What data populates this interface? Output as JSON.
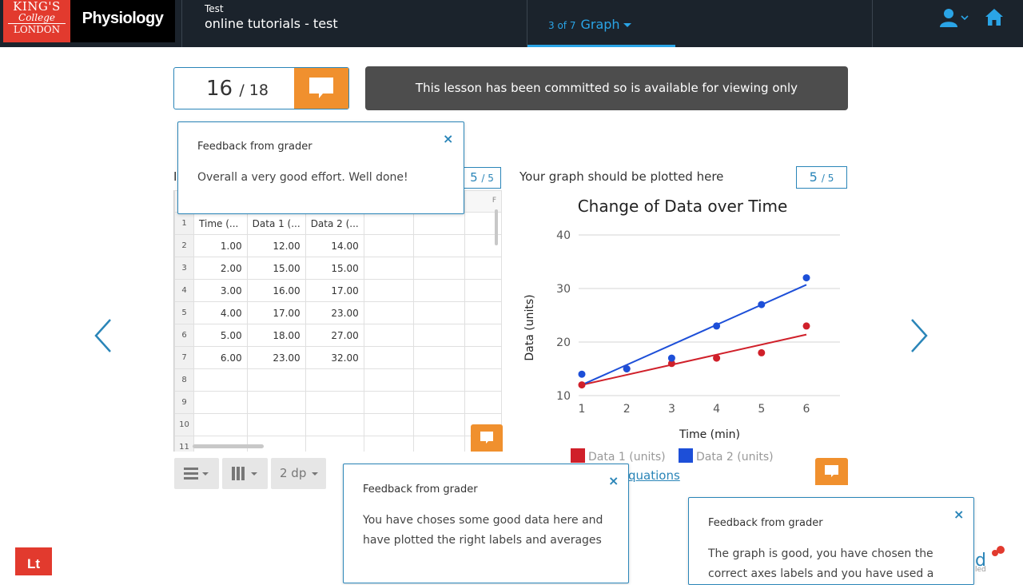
{
  "header": {
    "institution_line1": "KING'S",
    "institution_line2": "College",
    "institution_line3": "LONDON",
    "subject": "Physiology",
    "course_small": "Test",
    "course_title": "online tutorials - test",
    "lesson_position": "3 of 7",
    "lesson_name": "Graph",
    "accent_color": "#2aa4e6",
    "icons": [
      "user-icon",
      "chevron-down-icon",
      "home-icon"
    ]
  },
  "score": {
    "value": "16",
    "total": "/ 18"
  },
  "banner": {
    "text": "This lesson has been committed so is available for viewing only"
  },
  "feedback_top": {
    "title": "Feedback from grader",
    "body": "Overall a very good effort. Well done!",
    "close": "×"
  },
  "feedback_left": {
    "title": "Feedback from grader",
    "body_line1": "You have choses some good data here and",
    "body_line2": "have plotted the right labels and averages",
    "close": "×"
  },
  "feedback_right": {
    "title": "Feedback from grader",
    "body_line1": "The graph is good, you have chosen the",
    "body_line2": "correct axes labels and you have used a",
    "close": "×"
  },
  "left_panel": {
    "label_fragment": "I",
    "score_value": "5",
    "score_total": "/ 5",
    "column_letter_f": "F",
    "headers": [
      "Time (...",
      "Data 1 (...",
      "Data 2 (..."
    ],
    "rows": [
      [
        "1.00",
        "12.00",
        "14.00"
      ],
      [
        "2.00",
        "15.00",
        "15.00"
      ],
      [
        "3.00",
        "16.00",
        "17.00"
      ],
      [
        "4.00",
        "17.00",
        "23.00"
      ],
      [
        "5.00",
        "18.00",
        "27.00"
      ],
      [
        "6.00",
        "23.00",
        "32.00"
      ]
    ],
    "row_numbers": [
      "1",
      "2",
      "3",
      "4",
      "5",
      "6",
      "7",
      "8",
      "9",
      "10",
      "11"
    ],
    "toolbar": {
      "rows_button": "rows-menu",
      "columns_button": "columns-menu",
      "decimals_label": "2 dp"
    }
  },
  "right_panel": {
    "prompt": "Your graph should be plotted here",
    "score_value": "5",
    "score_total": "/ 5",
    "legend": [
      "Data 1 (units)",
      "Data 2 (units)"
    ],
    "equations_link": "quations"
  },
  "chart_data": {
    "type": "scatter",
    "title": "Change of Data over Time",
    "xlabel": "Time (min)",
    "ylabel": "Data (units)",
    "xlim": [
      1,
      6
    ],
    "ylim": [
      10,
      40
    ],
    "x_ticks": [
      1,
      2,
      3,
      4,
      5,
      6
    ],
    "y_ticks": [
      10,
      20,
      30,
      40
    ],
    "grid": true,
    "legend_position": "bottom",
    "series": [
      {
        "name": "Data 1 (units)",
        "color": "#d0202a",
        "x": [
          1,
          2,
          3,
          4,
          5,
          6
        ],
        "y": [
          12,
          15,
          16,
          17,
          18,
          23
        ],
        "trendline": [
          12,
          21.4
        ]
      },
      {
        "name": "Data 2 (units)",
        "color": "#1d4fd8",
        "x": [
          1,
          2,
          3,
          4,
          5,
          6
        ],
        "y": [
          14,
          15,
          17,
          23,
          27,
          32
        ],
        "trendline": [
          12,
          30.7
        ]
      }
    ]
  },
  "footer": {
    "lt_badge": "Lt",
    "brand_fragment": "led"
  }
}
